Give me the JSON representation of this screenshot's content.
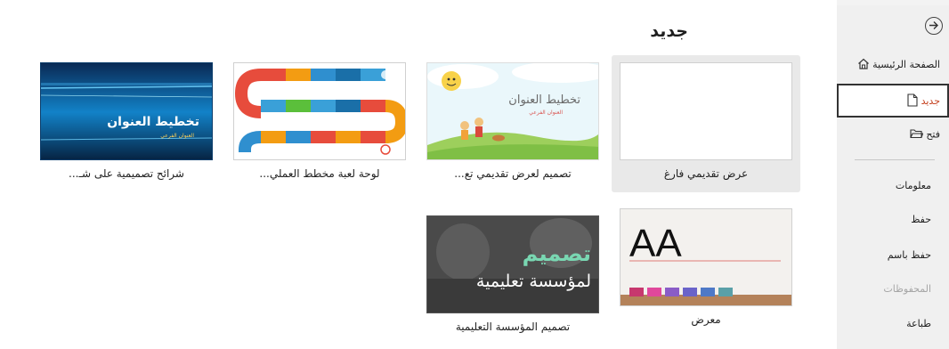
{
  "page": {
    "title": "جديد"
  },
  "sidebar": {
    "home": "الصفحة الرئيسية",
    "new": "جديد",
    "open": "فتح",
    "info": "معلومات",
    "save": "حفظ",
    "save_as": "حفظ باسم",
    "history": "المحفوظات",
    "print": "طباعة"
  },
  "templates": [
    {
      "caption": "عرض تقديمي فارغ",
      "selected": true
    },
    {
      "caption": "تصميم لعرض تقديمي تع...",
      "thumb_title": "تخطيط العنوان",
      "thumb_sub": "العنوان الفرعي"
    },
    {
      "caption": "لوحة لعبة مخطط العملي..."
    },
    {
      "caption": "شرائح تصميمية على شـ...",
      "thumb_title": "تخطيط العنوان",
      "thumb_sub": "العنوان الفرعي"
    },
    {
      "caption": "معرض",
      "thumb_title": "AA"
    },
    {
      "caption": "تصميم المؤسسة التعليمية",
      "thumb_title": "تصميم",
      "thumb_sub": "لمؤسسة تعليمية"
    }
  ],
  "colors": {
    "accent": "#c43e1c",
    "sidebar_bg": "#f0f0f0",
    "selected_bg": "#e9e9e9"
  },
  "icons": [
    "back-arrow-icon",
    "home-icon",
    "new-file-icon",
    "folder-icon"
  ]
}
